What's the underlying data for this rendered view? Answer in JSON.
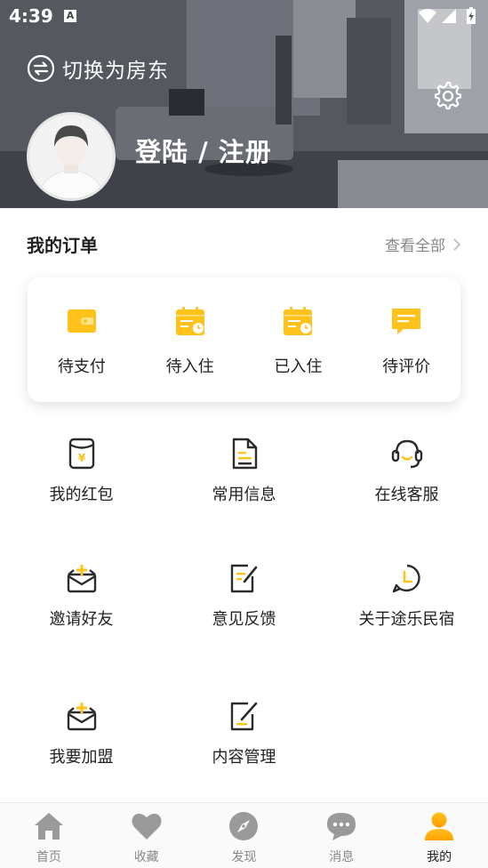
{
  "status_bar": {
    "time": "4:39",
    "notification_letter": "A"
  },
  "header": {
    "switch_label": "切换为房东",
    "login_label": "登陆 / 注册"
  },
  "orders": {
    "title": "我的订单",
    "see_all": "查看全部",
    "items": [
      {
        "label": "待支付",
        "icon": "wallet-icon"
      },
      {
        "label": "待入住",
        "icon": "calendar-clock-icon"
      },
      {
        "label": "已入住",
        "icon": "calendar-check-icon"
      },
      {
        "label": "待评价",
        "icon": "comment-icon"
      }
    ]
  },
  "services": [
    {
      "label": "我的红包",
      "icon": "red-packet-icon"
    },
    {
      "label": "常用信息",
      "icon": "document-icon"
    },
    {
      "label": "在线客服",
      "icon": "headset-icon"
    },
    {
      "label": "邀请好友",
      "icon": "invite-mail-icon"
    },
    {
      "label": "意见反馈",
      "icon": "feedback-edit-icon"
    },
    {
      "label": "关于途乐民宿",
      "icon": "about-clock-icon"
    },
    {
      "label": "我要加盟",
      "icon": "join-mail-icon"
    },
    {
      "label": "内容管理",
      "icon": "content-edit-icon"
    }
  ],
  "bottom_nav": [
    {
      "label": "首页",
      "icon": "home-icon",
      "active": false
    },
    {
      "label": "收藏",
      "icon": "heart-icon",
      "active": false
    },
    {
      "label": "发现",
      "icon": "compass-icon",
      "active": false
    },
    {
      "label": "消息",
      "icon": "message-icon",
      "active": false
    },
    {
      "label": "我的",
      "icon": "user-icon",
      "active": true
    }
  ],
  "colors": {
    "accent": "#FFC21A",
    "icon_dark": "#2b2b2b",
    "nav_inactive": "#9a9a9a",
    "nav_active": "#FFA800"
  }
}
